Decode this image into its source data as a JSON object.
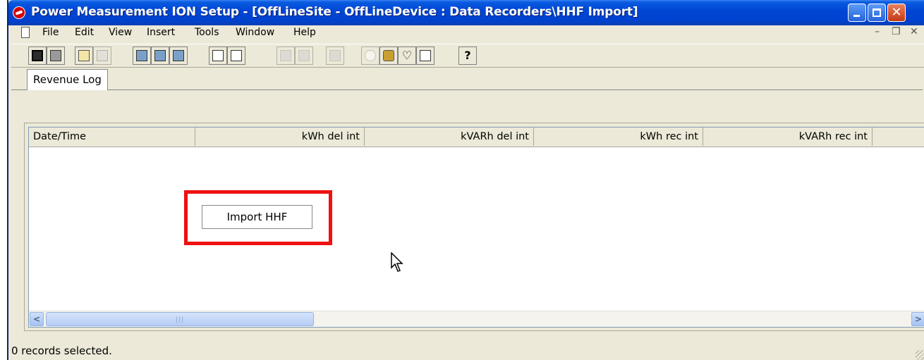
{
  "window": {
    "title": "Power Measurement ION Setup - [OffLineSite - OffLineDevice : Data Recorders\\HHF Import]"
  },
  "menu": [
    "File",
    "Edit",
    "View",
    "Insert",
    "Tools",
    "Window",
    "Help"
  ],
  "tabs": [
    {
      "label": "Revenue Log",
      "active": true
    }
  ],
  "columns": [
    "Date/Time",
    "kWh del int",
    "kVARh del int",
    "kWh rec int",
    "kVARh rec int"
  ],
  "rows": [],
  "import_button": {
    "label": "Import HHF"
  },
  "status": {
    "text": "0 records selected."
  },
  "colors": {
    "highlight": "#ee1111",
    "title_bar": "#0046d5"
  },
  "toolbar_icons": [
    "save-icon",
    "print-icon",
    "copy-icon",
    "properties-icon",
    "view-icon",
    "edit-icon",
    "network-icon",
    "find-icon",
    "preview-icon",
    "report-icon",
    "log-icon",
    "grid-icon",
    "clock-icon",
    "vault-icon",
    "diagnostics-icon",
    "check-icon",
    "help-icon"
  ]
}
